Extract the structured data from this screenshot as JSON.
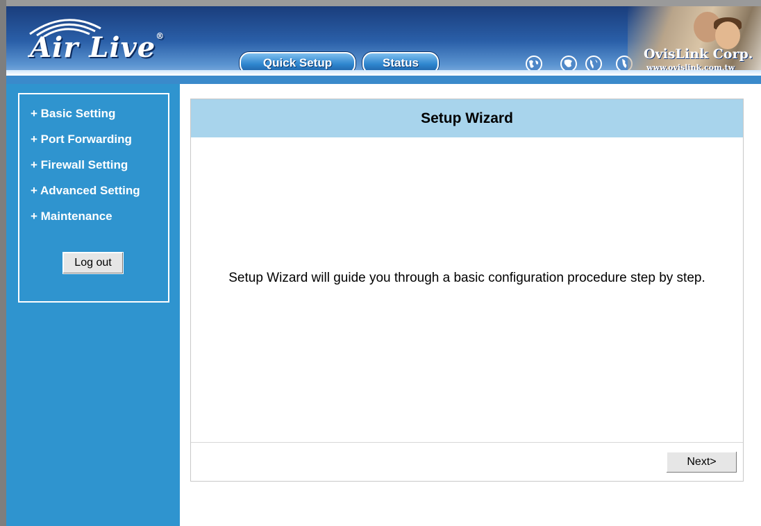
{
  "header": {
    "logo_text": "Air Live",
    "logo_mark": "®",
    "nav": [
      {
        "label": "Quick Setup"
      },
      {
        "label": "Status"
      }
    ],
    "globe_icons": [
      "globe-icon",
      "globe-icon",
      "globe-icon",
      "globe-icon"
    ],
    "company": "OvisLink Corp.",
    "company_url": "www.ovislink.com.tw"
  },
  "sidebar": {
    "items": [
      {
        "label": "+ Basic Setting"
      },
      {
        "label": "+ Port Forwarding"
      },
      {
        "label": "+ Firewall Setting"
      },
      {
        "label": "+ Advanced Setting"
      },
      {
        "label": "+ Maintenance"
      }
    ],
    "logout_label": "Log out"
  },
  "main": {
    "title": "Setup Wizard",
    "message": "Setup Wizard will guide you through a basic configuration procedure step by step.",
    "next_label": "Next>"
  },
  "colors": {
    "sidebar_bg": "#2f94cf",
    "panel_header_bg": "#a8d4ec",
    "header_dark": "#1a3d7c"
  }
}
